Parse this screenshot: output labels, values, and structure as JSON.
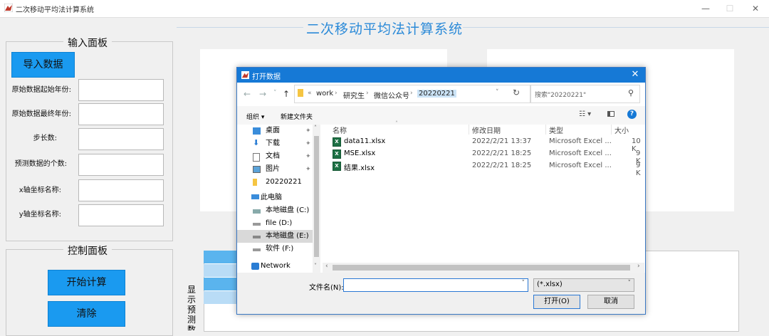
{
  "window": {
    "title": "二次移动平均法计算系统",
    "minimize_glyph": "—",
    "maximize_glyph": "☐",
    "close_glyph": "✕"
  },
  "header": {
    "title": "二次移动平均法计算系统"
  },
  "input_panel": {
    "title": "输入面板",
    "import_button": "导入数据",
    "fields": [
      {
        "label": "原始数据起始年份:",
        "value": ""
      },
      {
        "label": "原始数据最终年份:",
        "value": ""
      },
      {
        "label": "步长数:",
        "value": ""
      },
      {
        "label": "预测数据的个数:",
        "value": ""
      },
      {
        "label": "x轴坐标名称:",
        "value": ""
      },
      {
        "label": "y轴坐标名称:",
        "value": ""
      }
    ]
  },
  "control_panel": {
    "title": "控制面板",
    "start_button": "开始计算",
    "clear_button": "清除"
  },
  "result_label": "显示预测数",
  "dialog": {
    "title": "打开数据",
    "breadcrumb": [
      "«",
      "work",
      "研究生",
      "微信公众号",
      "20220221"
    ],
    "search_placeholder": "搜索\"20220221\"",
    "toolbar": {
      "organize": "组织 ▾",
      "new_folder": "新建文件夹"
    },
    "nav_items": [
      {
        "label": "桌面",
        "icon": "desktop-icon",
        "pinned": true
      },
      {
        "label": "下载",
        "icon": "download-icon",
        "pinned": true
      },
      {
        "label": "文档",
        "icon": "document-icon",
        "pinned": true
      },
      {
        "label": "图片",
        "icon": "picture-icon",
        "pinned": true
      },
      {
        "label": "20220221",
        "icon": "folder-icon",
        "pinned": false
      },
      {
        "label": "此电脑",
        "icon": "computer-icon",
        "pinned": false
      },
      {
        "label": "本地磁盘 (C:)",
        "icon": "drive-icon",
        "pinned": false
      },
      {
        "label": "file (D:)",
        "icon": "drive-icon",
        "pinned": false
      },
      {
        "label": "本地磁盘 (E:)",
        "icon": "drive-icon",
        "pinned": false,
        "selected": true
      },
      {
        "label": "软件 (F:)",
        "icon": "drive-icon",
        "pinned": false
      },
      {
        "label": "Network",
        "icon": "network-icon",
        "pinned": false
      }
    ],
    "columns": [
      "名称",
      "修改日期",
      "类型",
      "大小"
    ],
    "files": [
      {
        "name": "data11.xlsx",
        "modified": "2022/2/21 13:37",
        "type": "Microsoft Excel ...",
        "size": "10 K"
      },
      {
        "name": "MSE.xlsx",
        "modified": "2022/2/21 18:25",
        "type": "Microsoft Excel ...",
        "size": "9 K"
      },
      {
        "name": "结果.xlsx",
        "modified": "2022/2/21 18:25",
        "type": "Microsoft Excel ...",
        "size": "9 K"
      }
    ],
    "filename_label": "文件名(N):",
    "filename_value": "",
    "filter_value": "(*.xlsx)",
    "open_button": "打开(O)",
    "cancel_button": "取消"
  },
  "colors": {
    "accent": "#1a9af0",
    "dialog_title": "#1679d6",
    "header_title": "#2b8ad8"
  }
}
